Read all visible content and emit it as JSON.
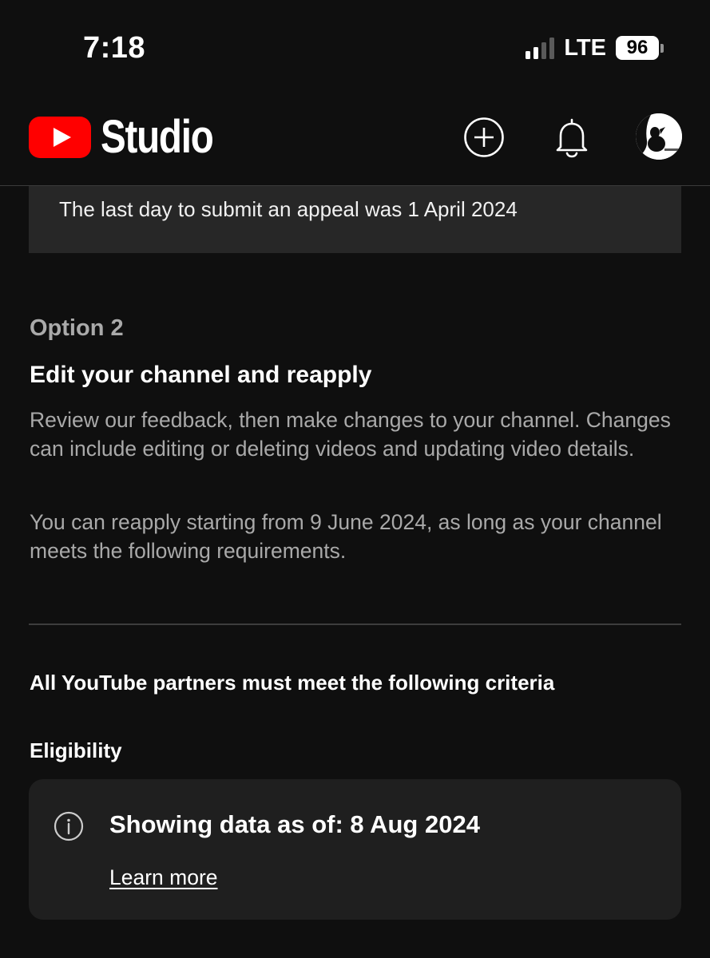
{
  "status_bar": {
    "time": "7:18",
    "network": "LTE",
    "battery": "96"
  },
  "header": {
    "app_name": "Studio",
    "icons": [
      "youtube-logo-icon",
      "create-icon",
      "bell-icon",
      "avatar"
    ],
    "brand_color": "#ff0000"
  },
  "appeal_notice": "The last day to submit an appeal was 1 April 2024",
  "option": {
    "label": "Option 2",
    "title": "Edit your channel and reapply",
    "description": "Review our feedback, then make changes to your channel. Changes can include editing or deleting videos and updating video details.",
    "reapply_text": "You can reapply starting from 9 June 2024, as long as your channel meets the following requirements."
  },
  "criteria_heading": "All YouTube partners must meet the following criteria",
  "eligibility_heading": "Eligibility",
  "info_card": {
    "icon": "info-icon",
    "title": "Showing data as of: 8 Aug 2024",
    "link_label": "Learn more"
  },
  "colors": {
    "background": "#0f0f0f",
    "surface": "#272727",
    "card": "#1f1f1f",
    "muted_text": "#aaaaaa"
  }
}
